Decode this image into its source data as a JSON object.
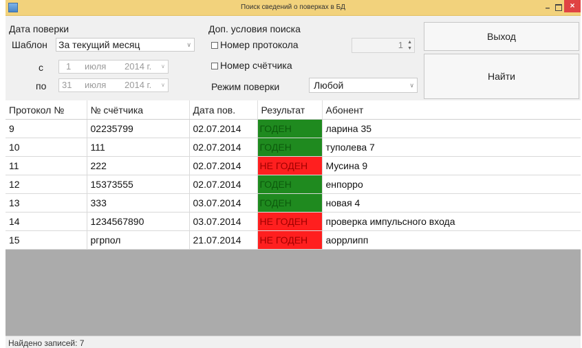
{
  "window": {
    "title": "Поиск сведений о поверках в БД",
    "minimize_label": "–",
    "close_label": "×"
  },
  "filters": {
    "date_group_label": "Дата поверки",
    "template_label": "Шаблон",
    "template_value": "За текущий месяц",
    "from_label": "с",
    "from_date": {
      "day": "1",
      "month": "июля",
      "year": "2014 г."
    },
    "to_label": "по",
    "to_date": {
      "day": "31",
      "month": "июля",
      "year": "2014 г."
    },
    "extra_group_label": "Доп. условия поиска",
    "protocol_check_label": "Номер протокола",
    "protocol_number_value": "1",
    "meter_check_label": "Номер счётчика",
    "mode_label": "Режим поверки",
    "mode_value": "Любой"
  },
  "buttons": {
    "exit_label": "Выход",
    "find_label": "Найти"
  },
  "table": {
    "columns": [
      "Протокол №",
      "№ счётчика",
      "Дата пов.",
      "Результат",
      "Абонент"
    ],
    "rows": [
      {
        "protocol": "9",
        "meter": "02235799",
        "date": "02.07.2014",
        "result": "ГОДЕН",
        "subscriber": "ларина 35"
      },
      {
        "protocol": "10",
        "meter": "111",
        "date": "02.07.2014",
        "result": "ГОДЕН",
        "subscriber": "туполева 7"
      },
      {
        "protocol": "11",
        "meter": "222",
        "date": "02.07.2014",
        "result": "НЕ ГОДЕН",
        "subscriber": "Мусина 9"
      },
      {
        "protocol": "12",
        "meter": "15373555",
        "date": "02.07.2014",
        "result": "ГОДЕН",
        "subscriber": "енпорро"
      },
      {
        "protocol": "13",
        "meter": "333",
        "date": "03.07.2014",
        "result": "ГОДЕН",
        "subscriber": "новая 4"
      },
      {
        "protocol": "14",
        "meter": "1234567890",
        "date": "03.07.2014",
        "result": "НЕ ГОДЕН",
        "subscriber": "проверка импульсного входа"
      },
      {
        "protocol": "15",
        "meter": "ргрпол",
        "date": "21.07.2014",
        "result": "НЕ ГОДЕН",
        "subscriber": "аоррлипп"
      }
    ]
  },
  "status": {
    "text": "Найдено записей: 7"
  },
  "colors": {
    "title_bar": "#f2d27c",
    "close_button": "#e04343",
    "pass": "#1f8a1f",
    "pass_text": "#0c5a0c",
    "fail": "#ff1f1f",
    "fail_text": "#a00000",
    "empty_grid": "#ababab"
  },
  "icons": {
    "app": "app-window-icon",
    "dropdown": "chevron-down-icon",
    "spin": "spin-arrows-icon"
  }
}
